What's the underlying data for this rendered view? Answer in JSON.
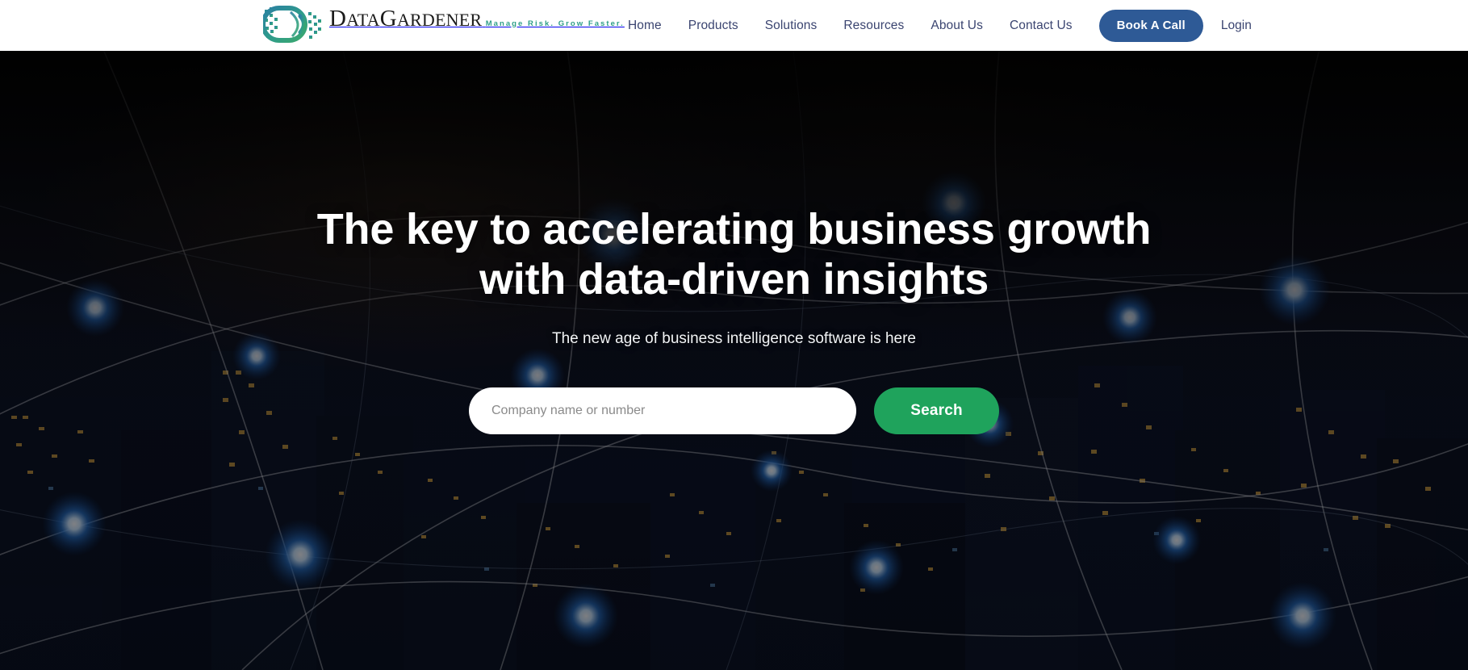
{
  "header": {
    "logo": {
      "name": "DataGardener",
      "part1": "D",
      "part2": "ATA",
      "part3": "G",
      "part4": "ARDENER",
      "tagline": "Manage Risk. Grow Faster.",
      "mark_icon": "datagardener-logo-icon"
    },
    "nav": [
      {
        "label": "Home"
      },
      {
        "label": "Products"
      },
      {
        "label": "Solutions"
      },
      {
        "label": "Resources"
      },
      {
        "label": "About Us"
      },
      {
        "label": "Contact Us"
      }
    ],
    "cta": {
      "label": "Book A Call",
      "color": "#2e5a96"
    },
    "login": {
      "label": "Login"
    },
    "background": "#ffffff",
    "link_color": "#3a4470"
  },
  "hero": {
    "headline": "The key to accelerating business growth with data-driven insights",
    "subheadline": "The new age of business intelligence software is here",
    "search": {
      "placeholder": "Company name or number",
      "value": "",
      "button_label": "Search",
      "button_color": "#1fa35c"
    },
    "background_description": "night city skyline with glowing blue network nodes"
  },
  "colors": {
    "brand_teal": "#2e9e88",
    "brand_navy": "#2e5a96",
    "accent_green": "#1fa35c",
    "hero_dark": "#05070c"
  }
}
